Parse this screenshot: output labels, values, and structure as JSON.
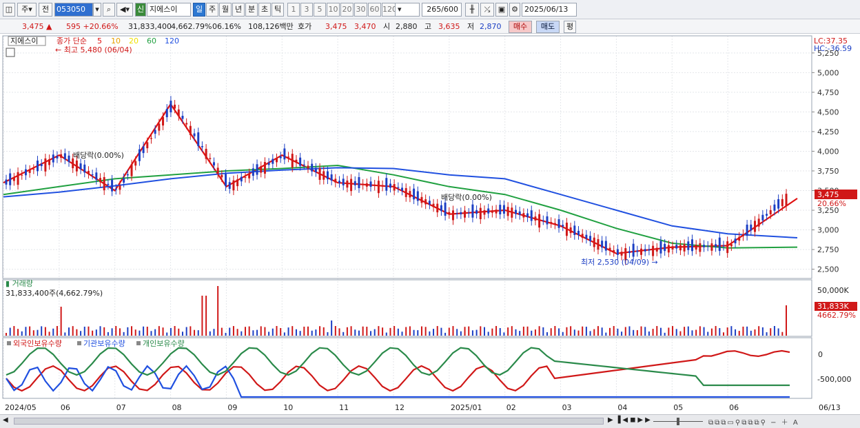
{
  "toolbar": {
    "period_type": "주",
    "prev": "전",
    "stock_code": "053050",
    "stock_tag": "신",
    "stock_name": "지에스이",
    "timeframes": [
      "일",
      "주",
      "월",
      "년",
      "분",
      "초",
      "틱"
    ],
    "active_timeframe": "일",
    "intervals": [
      "1",
      "3",
      "5",
      "10",
      "20",
      "30",
      "60",
      "120"
    ],
    "count": "265",
    "max_count": "/600",
    "date": "2025/06/13"
  },
  "quote": {
    "price": "3,475",
    "change": "595",
    "change_pct": "+20.66%",
    "volume": "31,833,400",
    "volume_pct": "4,662.79%",
    "turnover": "06.16%",
    "amount": "108,126백만",
    "bid_label": "호가",
    "ask": "3,475",
    "bid": "3,470",
    "open_label": "시",
    "open": "2,880",
    "high_label": "고",
    "high": "3,635",
    "low_label": "저",
    "low": "2,870",
    "buy_label": "매수",
    "sell_label": "매도",
    "eval_label": "평"
  },
  "price_panel": {
    "stock_label": "지에스이",
    "legend_title": "종가 단순",
    "ma_periods": [
      "5",
      "10",
      "20",
      "60",
      "120"
    ],
    "ma_colors": [
      "#e01010",
      "#e8a000",
      "#f0e000",
      "#20a040",
      "#2050e0"
    ],
    "high_annotation": "최고 5,480 (06/04)",
    "low_annotation": "최저 2,530 (04/09)",
    "dividend_labels": [
      "배당락(0.00%)",
      "배당락(0.00%)"
    ],
    "lc": "LC:37.35",
    "hc": "HC:-36.59",
    "y_ticks": [
      "5,250",
      "5,000",
      "4,750",
      "4,500",
      "4,250",
      "4,000",
      "3,750",
      "3,500",
      "3,250",
      "3,000",
      "2,750",
      "2,500"
    ],
    "current_price": "3,475",
    "current_pct": "20.66%"
  },
  "volume_panel": {
    "title": "거래량",
    "last_volume": "31,833,400주(4,662.79%)",
    "y_tick": "50,000K",
    "current_volume": "31,833K",
    "current_pct": "4662.79%"
  },
  "holdings_panel": {
    "legend": [
      "외국인보유수량",
      "기관보유수량",
      "개인보유수량"
    ],
    "colors": [
      "#d01818",
      "#2050e0",
      "#2a8a4a"
    ],
    "y_ticks": [
      "0",
      "-500,000"
    ]
  },
  "x_axis": [
    "2024/05",
    "06",
    "07",
    "08",
    "09",
    "10",
    "11",
    "12",
    "2025/01",
    "02",
    "03",
    "04",
    "05",
    "06",
    "06/13"
  ],
  "chart_data": {
    "type": "line",
    "title": "",
    "xlabel": "",
    "ylabel": "",
    "ylim": [
      2400,
      5450
    ],
    "x": [
      "2024/05",
      "2024/06",
      "2024/07",
      "2024/08",
      "2024/09",
      "2024/10",
      "2024/11",
      "2024/12",
      "2025/01",
      "2025/02",
      "2025/03",
      "2025/04",
      "2025/05",
      "2025/06",
      "06/13"
    ],
    "series": [
      {
        "name": "종가 단순 5",
        "values": [
          3600,
          3950,
          3500,
          4600,
          3550,
          3950,
          3600,
          3550,
          3200,
          3250,
          3050,
          2700,
          2780,
          2800,
          3400
        ]
      },
      {
        "name": "종가 단순 60",
        "values": [
          3450,
          3550,
          3650,
          3700,
          3750,
          3780,
          3820,
          3700,
          3550,
          3450,
          3250,
          3020,
          2830,
          2770,
          2780
        ]
      },
      {
        "name": "종가 단순 120",
        "values": [
          3420,
          3480,
          3560,
          3650,
          3720,
          3760,
          3790,
          3780,
          3700,
          3650,
          3450,
          3250,
          3050,
          2950,
          2900
        ]
      }
    ]
  }
}
